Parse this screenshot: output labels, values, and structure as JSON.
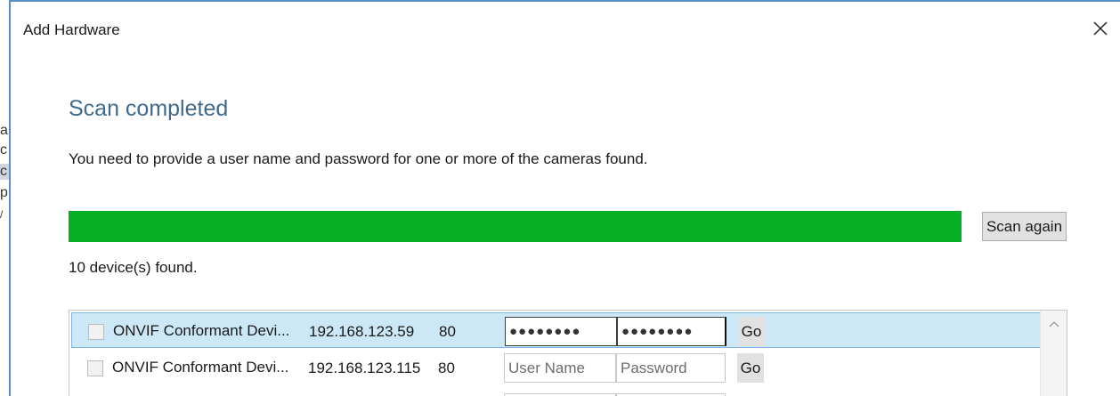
{
  "dialog": {
    "title": "Add Hardware"
  },
  "background_fragments": [
    "a",
    "c",
    "c",
    "p",
    "/"
  ],
  "scan": {
    "heading": "Scan completed",
    "description": "You need to provide a user name and password for one or more of the cameras found.",
    "progress_percent": 100,
    "progress_color": "#06b025",
    "scan_again_label": "Scan again",
    "found_text": "10 device(s) found."
  },
  "devices": [
    {
      "name": "ONVIF Conformant Devi...",
      "ip": "192.168.123.59",
      "port": "80",
      "username_value": "●●●●●●●●",
      "password_value": "●●●●●●●●",
      "go_label": "Go"
    },
    {
      "name": "ONVIF Conformant Devi...",
      "ip": "192.168.123.115",
      "port": "80",
      "username_placeholder": "User Name",
      "password_placeholder": "Password",
      "go_label": "Go"
    }
  ],
  "icons": {
    "close": "close-icon",
    "scroll_up": "chevron-up-icon"
  },
  "colors": {
    "accent_border": "#5a8fc6",
    "heading": "#3f6a8e",
    "selected_row": "#cce8f6"
  }
}
